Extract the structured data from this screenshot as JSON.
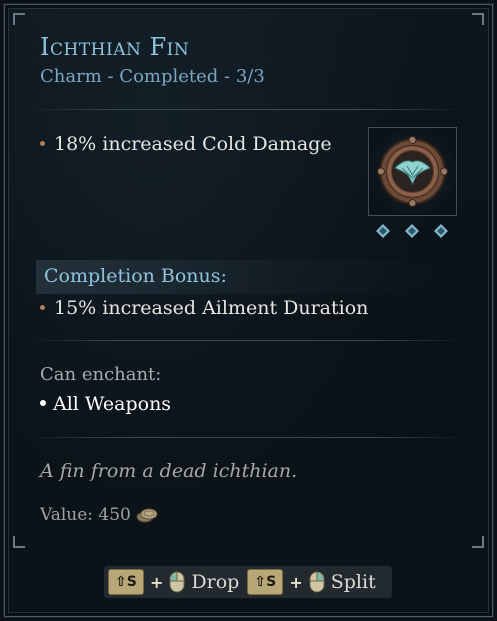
{
  "item": {
    "name": "Ichthian Fin",
    "subtitle": "Charm - Completed - 3/3",
    "modifiers": [
      "18% increased Cold Damage"
    ],
    "completion_bonus_label": "Completion Bonus:",
    "completion_bonus_mods": [
      "15% increased Ailment Duration"
    ],
    "enchant_label": "Can enchant:",
    "enchant_items": [
      "All Weapons"
    ],
    "flavor_text": "A fin from a dead ichthian.",
    "value_text": "Value: 450",
    "icon": "fin-charm-icon",
    "progress_pips": 3
  },
  "hints": [
    {
      "key": "⇧S",
      "mouse": "left-mouse-icon",
      "label": "Drop"
    },
    {
      "key": "⇧S",
      "mouse": "right-mouse-icon",
      "label": "Split"
    }
  ],
  "colors": {
    "title": "#8fc3de",
    "subtitle": "#7aa7c2",
    "bullet": "#b27d5a",
    "text": "#e6e6e2",
    "muted": "#a9adad",
    "key": "#b8a777"
  }
}
